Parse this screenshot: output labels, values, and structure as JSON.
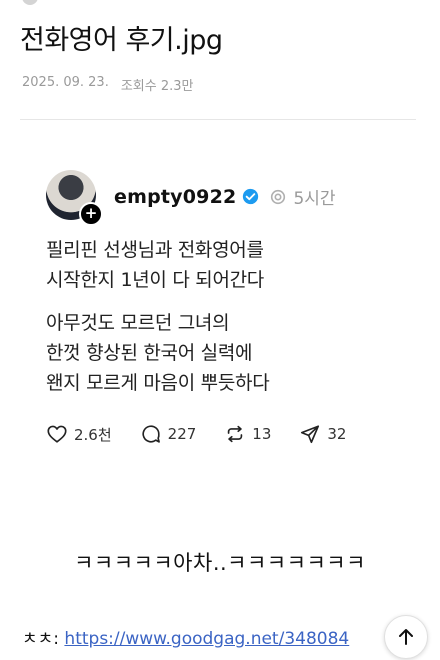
{
  "post": {
    "title": "전화영어 후기.jpg",
    "date": "2025. 09. 23.",
    "views": "조회수 2.3만"
  },
  "thread": {
    "username": "empty0922",
    "time": "5시간",
    "paragraphs": [
      "필리핀 선생님과 전화영어를\n시작한지 1년이 다 되어간다",
      "아무것도 모르던 그녀의\n한껏 향상된 한국어 실력에\n왠지 모르게 마음이 뿌듯하다"
    ],
    "likes": "2.6천",
    "comments": "227",
    "reposts": "13",
    "shares": "32"
  },
  "comment_text": "ㅋㅋㅋㅋㅋ아차..ㅋㅋㅋㅋㅋㅋㅋ",
  "source": {
    "prefix": "ㅊㅊ: ",
    "url": "https://www.goodgag.net/348084"
  },
  "icons": {
    "avatar_plus": "plus-icon",
    "verified": "verified-badge-icon",
    "threads": "threads-icon",
    "like": "heart-icon",
    "comment": "comment-bubble-icon",
    "repost": "repost-icon",
    "share": "send-icon",
    "scroll_top": "arrow-up-icon"
  },
  "colors": {
    "verified": "#1d9bf0",
    "link": "#3b64c4",
    "meta": "#9a9a9a"
  }
}
